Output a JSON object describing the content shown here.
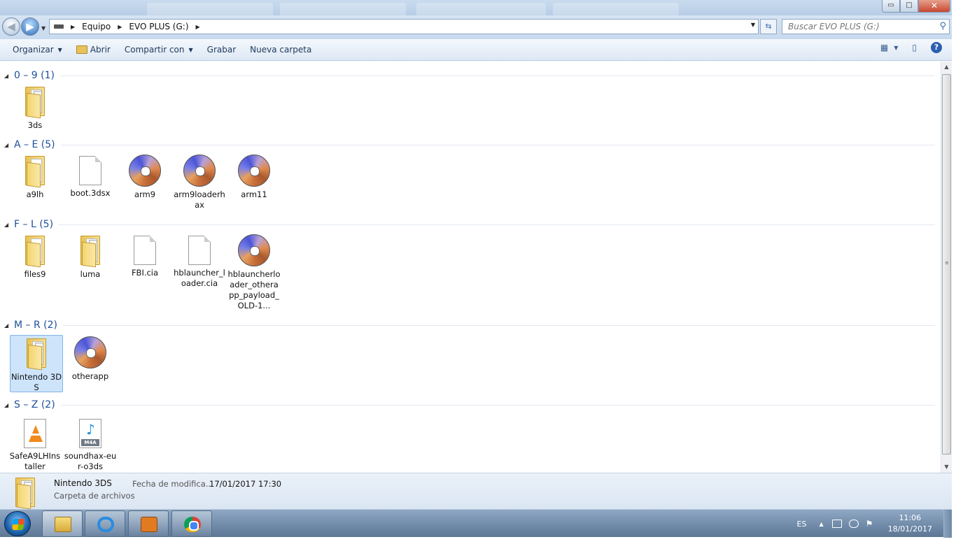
{
  "window": {
    "controls": {
      "minimize": "▭",
      "maximize": "□",
      "close": "✕"
    }
  },
  "address": {
    "crumbs": [
      "Equipo",
      "EVO PLUS (G:)"
    ],
    "search_placeholder": "Buscar EVO PLUS (G:)"
  },
  "toolbar": {
    "organize": "Organizar",
    "open": "Abrir",
    "share": "Compartir con",
    "burn": "Grabar",
    "new_folder": "Nueva carpeta",
    "help": "?"
  },
  "groups": [
    {
      "header": "0 – 9 (1)",
      "items": [
        {
          "label": "3ds",
          "kind": "folder-icon"
        }
      ]
    },
    {
      "header": "A – E (5)",
      "items": [
        {
          "label": "a9lh",
          "kind": "folder-icon"
        },
        {
          "label": "boot.3dsx",
          "kind": "file-icon"
        },
        {
          "label": "arm9",
          "kind": "disc-image-icon"
        },
        {
          "label": "arm9loaderhax",
          "kind": "disc-image-icon"
        },
        {
          "label": "arm11",
          "kind": "disc-image-icon"
        }
      ]
    },
    {
      "header": "F – L (5)",
      "items": [
        {
          "label": "files9",
          "kind": "folder-icon"
        },
        {
          "label": "luma",
          "kind": "folder-icon"
        },
        {
          "label": "FBI.cia",
          "kind": "file-icon"
        },
        {
          "label": "hblauncher_loader.cia",
          "kind": "file-icon"
        },
        {
          "label": "hblauncherloader_otherapp_payload_OLD-1...",
          "kind": "disc-image-icon"
        }
      ]
    },
    {
      "header": "M – R (2)",
      "items": [
        {
          "label": "Nintendo 3DS",
          "kind": "folder-icon",
          "selected": true
        },
        {
          "label": "otherapp",
          "kind": "disc-image-icon"
        }
      ]
    },
    {
      "header": "S – Z (2)",
      "items": [
        {
          "label": "SafeA9LHInstaller",
          "kind": "vlc-icon"
        },
        {
          "label": "soundhax-eur-o3ds",
          "kind": "m4a-icon"
        }
      ]
    }
  ],
  "details": {
    "name": "Nintendo 3DS",
    "modified_label": "Fecha de modifica...",
    "modified_value": "17/01/2017 17:30",
    "type": "Carpeta de archivos"
  },
  "taskbar": {
    "language": "ES",
    "time": "11:06",
    "date": "18/01/2017"
  }
}
